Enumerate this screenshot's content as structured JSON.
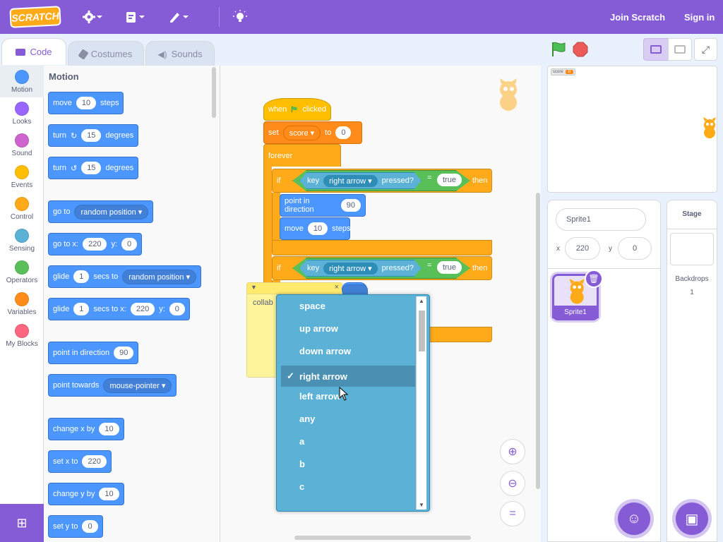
{
  "menubar": {
    "logo": "SCRATCH",
    "join": "Join Scratch",
    "signin": "Sign in"
  },
  "tabs": {
    "code": "Code",
    "costumes": "Costumes",
    "sounds": "Sounds"
  },
  "categories": [
    {
      "label": "Motion",
      "color": "#4c97ff"
    },
    {
      "label": "Looks",
      "color": "#9966ff"
    },
    {
      "label": "Sound",
      "color": "#cf63cf"
    },
    {
      "label": "Events",
      "color": "#ffbf00"
    },
    {
      "label": "Control",
      "color": "#ffab19"
    },
    {
      "label": "Sensing",
      "color": "#5cb1d6"
    },
    {
      "label": "Operators",
      "color": "#59c059"
    },
    {
      "label": "Variables",
      "color": "#ff8c1a"
    },
    {
      "label": "My Blocks",
      "color": "#ff6680"
    }
  ],
  "palette": {
    "heading": "Motion",
    "move": {
      "a": "move",
      "v": "10",
      "b": "steps"
    },
    "turn_r": {
      "a": "turn",
      "v": "15",
      "b": "degrees"
    },
    "turn_l": {
      "a": "turn",
      "v": "15",
      "b": "degrees"
    },
    "goto": {
      "a": "go to",
      "d": "random position"
    },
    "gotoxy": {
      "a": "go to x:",
      "x": "220",
      "b": "y:",
      "y": "0"
    },
    "glide1": {
      "a": "glide",
      "v": "1",
      "b": "secs to",
      "d": "random position"
    },
    "glide2": {
      "a": "glide",
      "v": "1",
      "b": "secs to x:",
      "x": "220",
      "c": "y:",
      "y": "0"
    },
    "pointdir": {
      "a": "point in direction",
      "v": "90"
    },
    "towards": {
      "a": "point towards",
      "d": "mouse-pointer"
    },
    "chx": {
      "a": "change x by",
      "v": "10"
    },
    "setx": {
      "a": "set x to",
      "v": "220"
    },
    "chy": {
      "a": "change y by",
      "v": "10"
    },
    "sety": {
      "a": "set y to",
      "v": "0"
    }
  },
  "script": {
    "when": "when",
    "clicked": "clicked",
    "set": "set",
    "var": "score",
    "to": "to",
    "val": "0",
    "forever": "forever",
    "if1": {
      "if": "if",
      "key": "key",
      "k": "right arrow",
      "pressed": "pressed?",
      "eq": "=",
      "t": "true",
      "then": "then"
    },
    "point": {
      "a": "point in direction",
      "v": "90"
    },
    "move": {
      "a": "move",
      "v": "10",
      "b": "steps"
    },
    "if2": {
      "if": "if",
      "key": "key",
      "k": "right arrow",
      "pressed": "pressed?",
      "eq": "=",
      "t": "true",
      "then": "then"
    },
    "comment": "collab"
  },
  "dropdown": {
    "options": [
      "space",
      "up arrow",
      "down arrow",
      "right arrow",
      "left arrow",
      "any",
      "a",
      "b",
      "c"
    ],
    "selected": "right arrow",
    "check": "✓"
  },
  "stage_monitor": {
    "label": "score",
    "value": "0"
  },
  "sprite_info": {
    "name": "Sprite1",
    "x_label": "x",
    "x": "220",
    "y_label": "y",
    "y": "0"
  },
  "sprite_list": [
    {
      "name": "Sprite1"
    }
  ],
  "stage_pane": {
    "title": "Stage",
    "backdrops_label": "Backdrops",
    "backdrops_count": "1"
  },
  "zoom": {
    "in": "+",
    "out": "−",
    "reset": "="
  }
}
